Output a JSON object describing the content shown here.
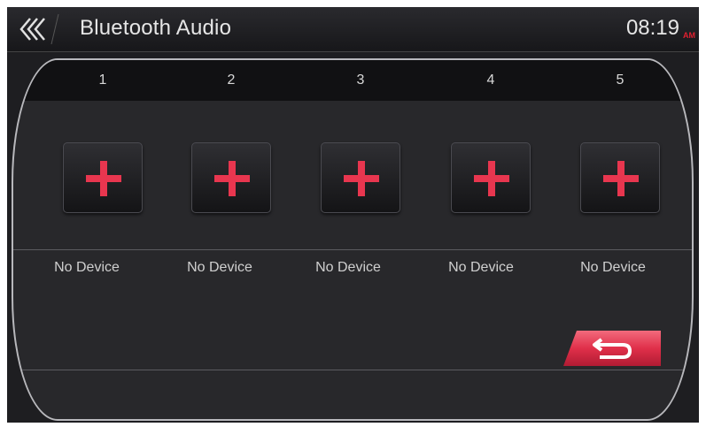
{
  "header": {
    "title": "Bluetooth Audio",
    "time": "08:19",
    "ampm": "AM"
  },
  "slots": [
    {
      "number": "1",
      "status": "No Device"
    },
    {
      "number": "2",
      "status": "No Device"
    },
    {
      "number": "3",
      "status": "No Device"
    },
    {
      "number": "4",
      "status": "No Device"
    },
    {
      "number": "5",
      "status": "No Device"
    }
  ],
  "colors": {
    "accent": "#e8364f",
    "background": "#1e1e21"
  },
  "icons": {
    "back": "triple-chevron-left-icon",
    "add": "plus-icon",
    "return": "return-arrow-icon"
  }
}
